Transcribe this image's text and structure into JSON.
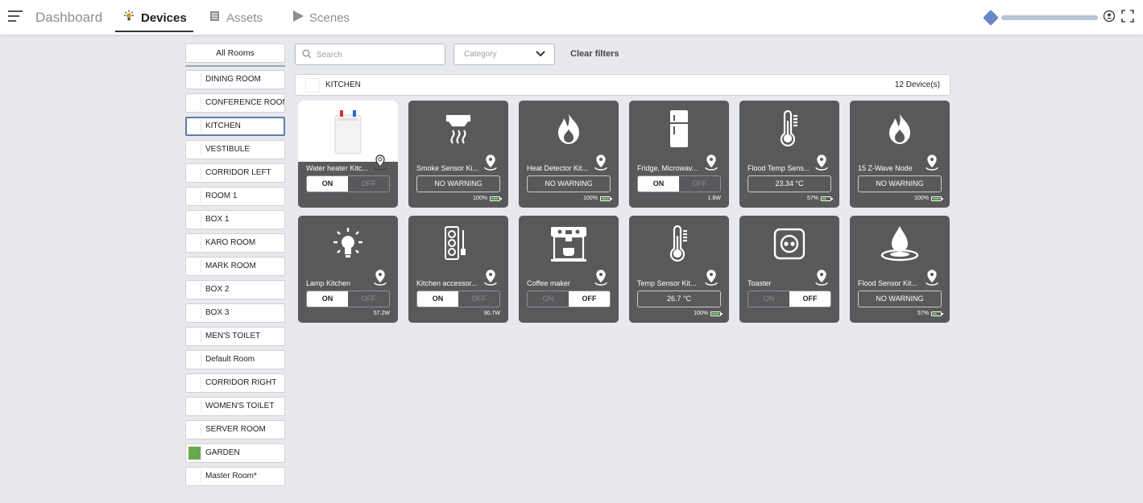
{
  "nav": {
    "dashboard": "Dashboard",
    "devices": "Devices",
    "assets": "Assets",
    "scenes": "Scenes"
  },
  "filters": {
    "search_placeholder": "Search",
    "category_placeholder": "Category",
    "clear_label": "Clear filters"
  },
  "rooms": {
    "all_label": "All Rooms",
    "items": [
      {
        "label": "DINING ROOM",
        "color": "#ffffff"
      },
      {
        "label": "CONFERENCE ROOM",
        "color": "#ffffff"
      },
      {
        "label": "KITCHEN",
        "color": "#ffffff",
        "selected": true
      },
      {
        "label": "VESTIBULE",
        "color": "#ffffff"
      },
      {
        "label": "CORRIDOR LEFT",
        "color": "#ffffff"
      },
      {
        "label": "ROOM 1",
        "color": "#ffffff"
      },
      {
        "label": "BOX 1",
        "color": "#ffffff"
      },
      {
        "label": "KARO ROOM",
        "color": "#ffffff"
      },
      {
        "label": "MARK ROOM",
        "color": "#ffffff"
      },
      {
        "label": "BOX 2",
        "color": "#ffffff"
      },
      {
        "label": "BOX 3",
        "color": "#ffffff"
      },
      {
        "label": "MEN'S TOILET",
        "color": "#ffffff"
      },
      {
        "label": "Default Room",
        "color": "#ffffff"
      },
      {
        "label": "CORRIDOR RIGHT",
        "color": "#ffffff"
      },
      {
        "label": "WOMEN'S TOILET",
        "color": "#ffffff"
      },
      {
        "label": "SERVER ROOM",
        "color": "#ffffff"
      },
      {
        "label": "GARDEN",
        "color": "#6aa84f"
      },
      {
        "label": "Master Room*",
        "color": "#ffffff"
      }
    ]
  },
  "room_header": {
    "name": "KITCHEN",
    "count": "12 Device(s)"
  },
  "devices": [
    {
      "name": "Water heater Kitc...",
      "icon": "water-heater-icon",
      "control": "toggle",
      "state": "on",
      "on_label": "ON",
      "off_label": "OFF",
      "meta": ""
    },
    {
      "name": "Smoke Sensor Ki...",
      "icon": "smoke-sensor-icon",
      "control": "status",
      "status": "NO WARNING",
      "meta": "100%",
      "battery": 1.0
    },
    {
      "name": "Heat Detector Kit...",
      "icon": "flame-icon",
      "control": "status",
      "status": "NO WARNING",
      "meta": "100%",
      "battery": 1.0
    },
    {
      "name": "Fridge, Microwav...",
      "icon": "fridge-icon",
      "control": "toggle",
      "state": "on",
      "on_label": "ON",
      "off_label": "OFF",
      "meta": "1.8W"
    },
    {
      "name": "Flood Temp Sens...",
      "icon": "thermometer-icon",
      "control": "status",
      "status": "23.34 °C",
      "meta": "57%",
      "battery": 0.57
    },
    {
      "name": "15 Z-Wave Node",
      "icon": "flame-icon",
      "control": "status",
      "status": "NO WARNING",
      "meta": "100%",
      "battery": 1.0
    },
    {
      "name": "Lamp Kitchen",
      "icon": "lightbulb-icon",
      "control": "toggle",
      "state": "on",
      "on_label": "ON",
      "off_label": "OFF",
      "meta": "57.2W"
    },
    {
      "name": "Kitchen accessor...",
      "icon": "power-strip-icon",
      "control": "toggle",
      "state": "on",
      "on_label": "ON",
      "off_label": "OFF",
      "meta": "90.7W"
    },
    {
      "name": "Coffee maker",
      "icon": "coffee-maker-icon",
      "control": "toggle",
      "state": "off",
      "on_label": "ON",
      "off_label": "OFF",
      "meta": ""
    },
    {
      "name": "Temp Sensor Kit...",
      "icon": "thermometer-icon",
      "control": "status",
      "status": "26.7 °C",
      "meta": "100%",
      "battery": 1.0
    },
    {
      "name": "Toaster",
      "icon": "wall-socket-icon",
      "control": "toggle",
      "state": "off",
      "on_label": "ON",
      "off_label": "OFF",
      "meta": ""
    },
    {
      "name": "Flood Sensor Kit...",
      "icon": "water-drop-icon",
      "control": "status",
      "status": "NO WARNING",
      "meta": "57%",
      "battery": 0.57
    }
  ]
}
